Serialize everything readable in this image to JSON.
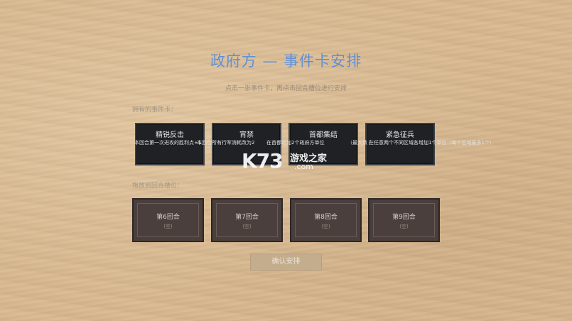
{
  "header": {
    "title": "政府方 — 事件卡安排",
    "subtitle": "点击一张事件卡，再点击回合槽位进行安排"
  },
  "hand": {
    "label": "拥有的事件卡：",
    "cards": [
      {
        "name": "精锐反击",
        "desc": "本回合第一次进攻的胜利点+1"
      },
      {
        "name": "宵禁",
        "desc": "本回合所有行军消耗改为2"
      },
      {
        "name": "首都集结",
        "desc": "在首都增加2个政府方单位"
      },
      {
        "name": "紧急征兵",
        "desc": "在任意两个不同区域各增加1个单位（每个区域最多1个）"
      }
    ],
    "desc_overlap_fragments": [
      "本回合第一次进攻的胜利点+1",
      "本回合所有行军消耗改为2",
      "在首都增加2个政府方单位",
      "（最大数 ）",
      "在任意两个不同区域各增加1个单位（每个区域最多1个）"
    ]
  },
  "slots": {
    "label": "拖放到回合槽位：",
    "items": [
      {
        "label": "第6回合",
        "empty": "(空)"
      },
      {
        "label": "第7回合",
        "empty": "(空)"
      },
      {
        "label": "第8回合",
        "empty": "(空)"
      },
      {
        "label": "第9回合",
        "empty": "(空)"
      }
    ]
  },
  "confirm_label": "确认安排",
  "watermark": {
    "brand": "K73",
    "cn": "游戏之家",
    "domain": ".com"
  }
}
